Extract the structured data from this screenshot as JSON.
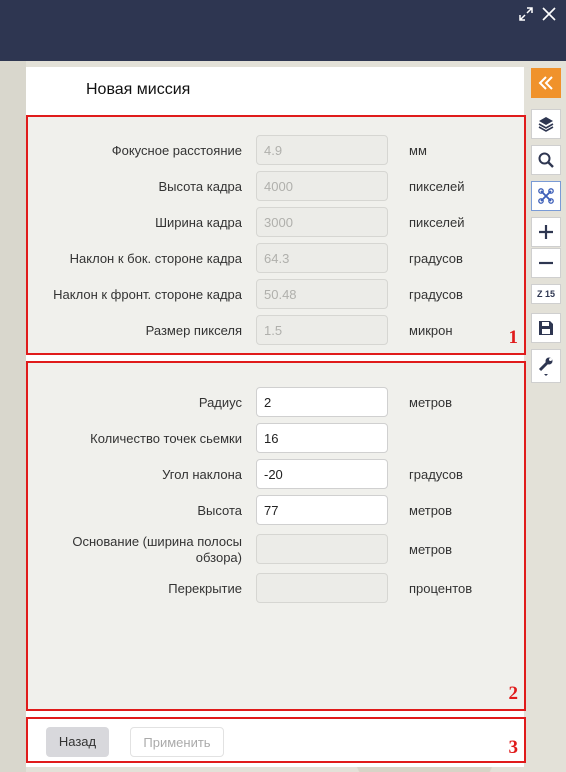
{
  "window": {
    "expand_icon": "expand-diagonal-icon",
    "close_icon": "close-icon"
  },
  "panel": {
    "title": "Новая миссия"
  },
  "camera": {
    "marker": "1",
    "fields": [
      {
        "label": "Фокусное расстояние",
        "value": "4.9",
        "unit": "мм"
      },
      {
        "label": "Высота кадра",
        "value": "4000",
        "unit": "пикселей"
      },
      {
        "label": "Ширина кадра",
        "value": "3000",
        "unit": "пикселей"
      },
      {
        "label": "Наклон к бок. стороне кадра",
        "value": "64.3",
        "unit": "градусов"
      },
      {
        "label": "Наклон к фронт. стороне кадра",
        "value": "50.48",
        "unit": "градусов"
      },
      {
        "label": "Размер пикселя",
        "value": "1.5",
        "unit": "микрон"
      }
    ]
  },
  "mission": {
    "marker": "2",
    "fields": [
      {
        "label": "Радиус",
        "value": "2",
        "unit": "метров"
      },
      {
        "label": "Количество точек сьемки",
        "value": "16",
        "unit": ""
      },
      {
        "label": "Угол наклона",
        "value": "-20",
        "unit": "градусов"
      },
      {
        "label": "Высота",
        "value": "77",
        "unit": "метров"
      },
      {
        "label": "Основание (ширина полосы обзора)",
        "value": "",
        "unit": "метров"
      },
      {
        "label": "Перекрытие",
        "value": "",
        "unit": "процентов"
      }
    ]
  },
  "footer": {
    "marker": "3",
    "back_label": "Назад",
    "apply_label": "Применить"
  },
  "toolbar": {
    "zoom_label": "Z 15",
    "accent_color": "#f0922b",
    "icons": [
      "double-chevron-left-icon",
      "layers-icon",
      "search-icon",
      "drone-icon",
      "zoom-in-icon",
      "zoom-out-icon",
      "save-icon",
      "wrench-icon"
    ]
  }
}
